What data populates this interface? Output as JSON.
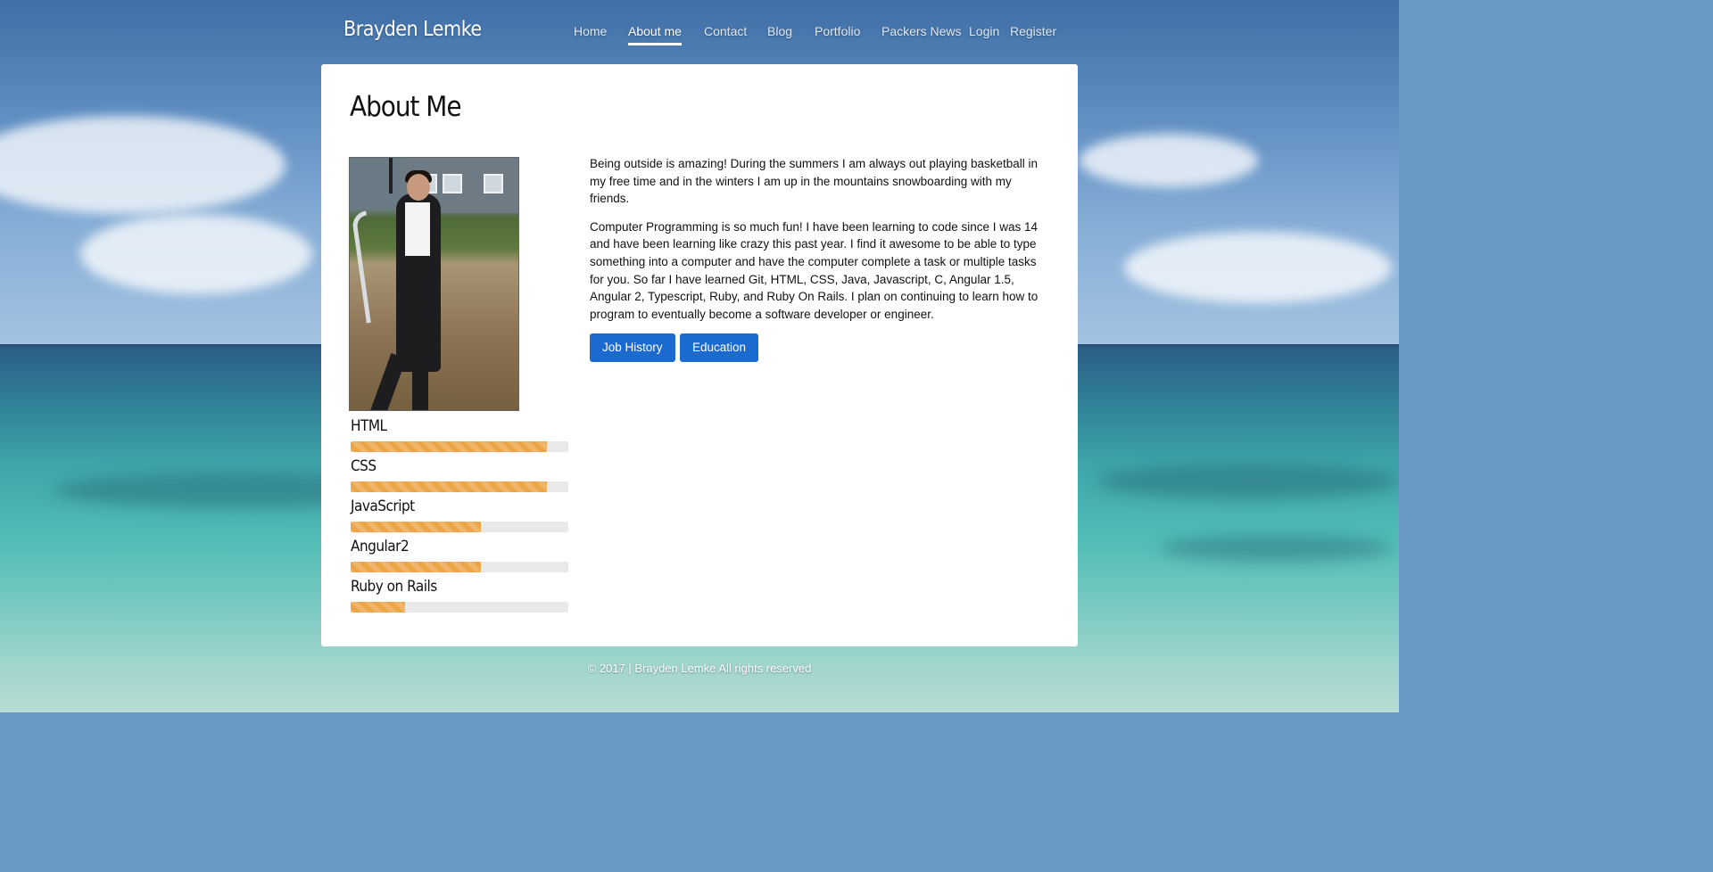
{
  "brand": "Brayden Lemke",
  "nav": {
    "items": [
      {
        "label": "Home",
        "active": false
      },
      {
        "label": "About me",
        "active": true
      },
      {
        "label": "Contact",
        "active": false
      },
      {
        "label": "Blog",
        "active": false
      },
      {
        "label": "Portfolio",
        "active": false
      },
      {
        "label": "Packers News",
        "active": false
      },
      {
        "label": "Login",
        "active": false
      },
      {
        "label": "Register",
        "active": false
      }
    ]
  },
  "main": {
    "title": "About Me",
    "skills": [
      {
        "label": "HTML",
        "level": 0.9
      },
      {
        "label": "CSS",
        "level": 0.9
      },
      {
        "label": "JavaScript",
        "level": 0.6
      },
      {
        "label": "Angular2",
        "level": 0.6
      },
      {
        "label": "Ruby on Rails",
        "level": 0.25
      }
    ],
    "paragraphs": [
      "Being outside is amazing! During the summers I am always out playing basketball in my free time and in the winters I am up in the mountains snowboarding with my friends.",
      "Computer Programming is so much fun! I have been learning to code since I was 14 and have been learning like crazy this past year. I find it awesome to be able to type something into a computer and have the computer complete a task or multiple tasks for you. So far I have learned Git, HTML, CSS, Java, Javascript, C, Angular 1.5, Angular 2, Typescript, Ruby, and Ruby On Rails. I plan on continuing to learn how to program to eventually become a software developer or engineer."
    ],
    "buttons": {
      "job_history": "Job History",
      "education": "Education"
    }
  },
  "footer": "© 2017 | Brayden Lemke All rights reserved",
  "colors": {
    "accent_button": "#1a6ad0",
    "skill_bar": "#eca648"
  }
}
